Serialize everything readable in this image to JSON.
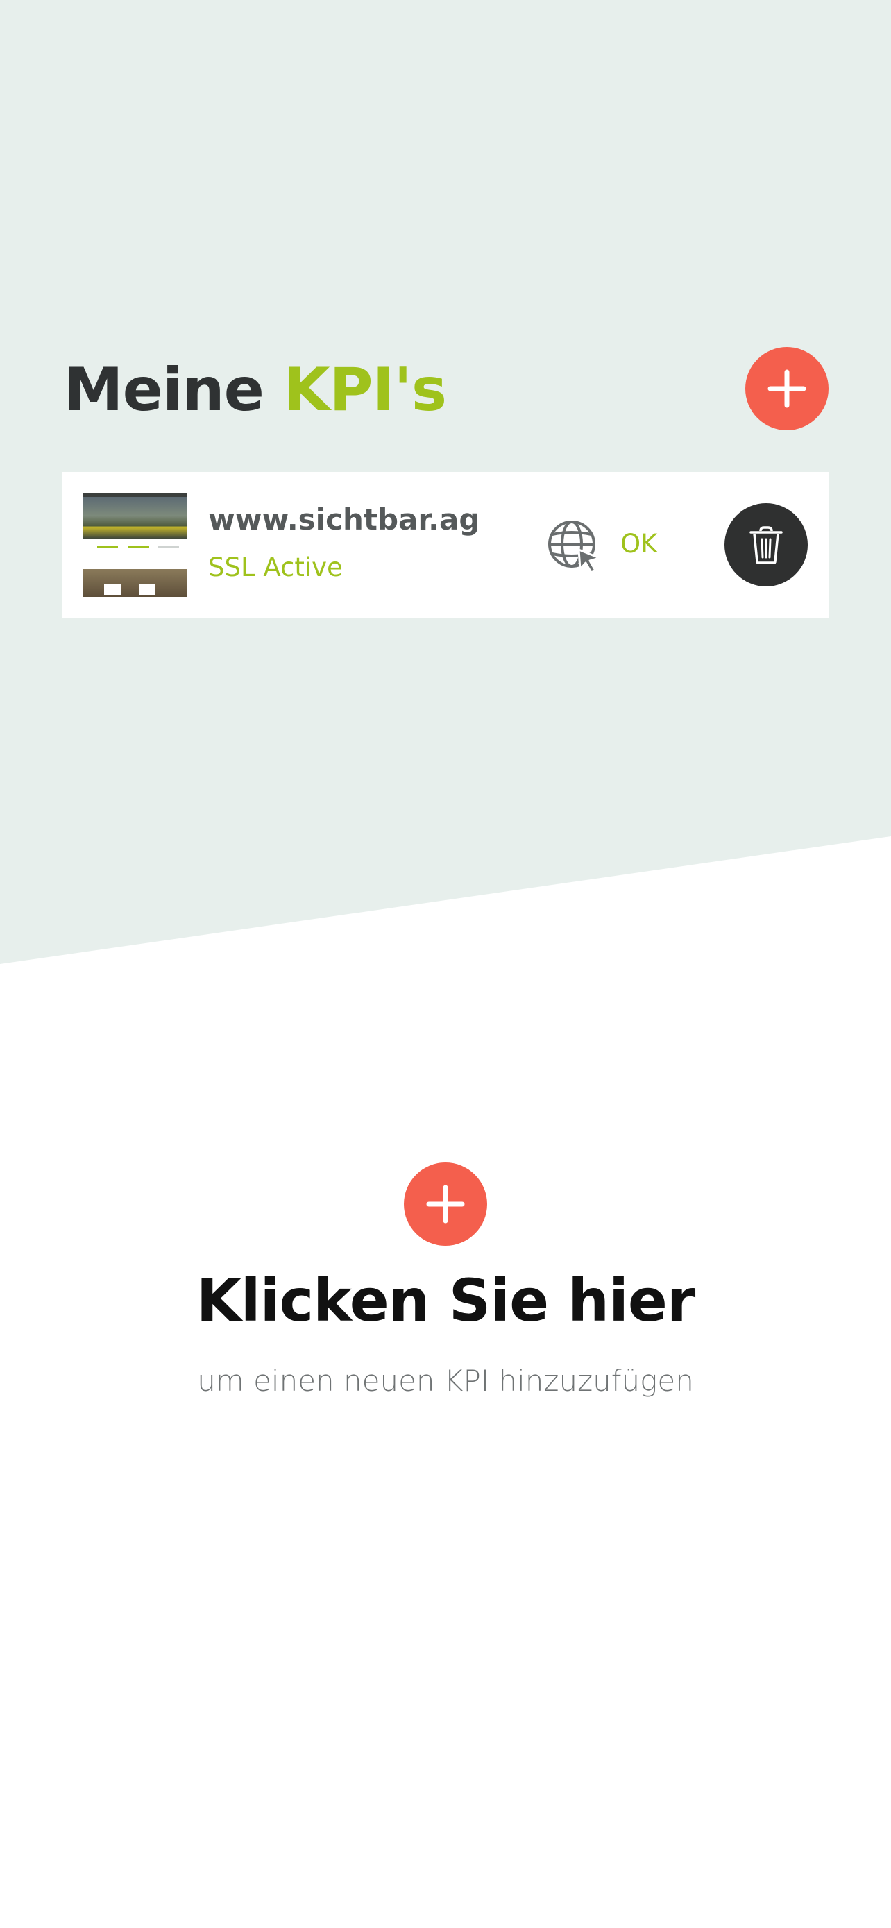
{
  "header": {
    "title_part1": "Meine ",
    "title_part2": "KPI's",
    "add_icon": "plus-icon"
  },
  "kpi_list": [
    {
      "site": "www.sichtbar.ag",
      "ssl_status": "SSL Active",
      "status_icon": "globe-cursor-icon",
      "status": "OK",
      "delete_icon": "trash-icon"
    }
  ],
  "cta": {
    "icon": "plus-icon",
    "title": "Klicken Sie hier",
    "subtitle": "um einen neuen KPI hinzuzufügen"
  },
  "colors": {
    "accent_green": "#9fc21c",
    "accent_red": "#f45f4d",
    "background_top": "#e7efec",
    "dark_button": "#2f3030",
    "title_dark": "#2f3233"
  }
}
